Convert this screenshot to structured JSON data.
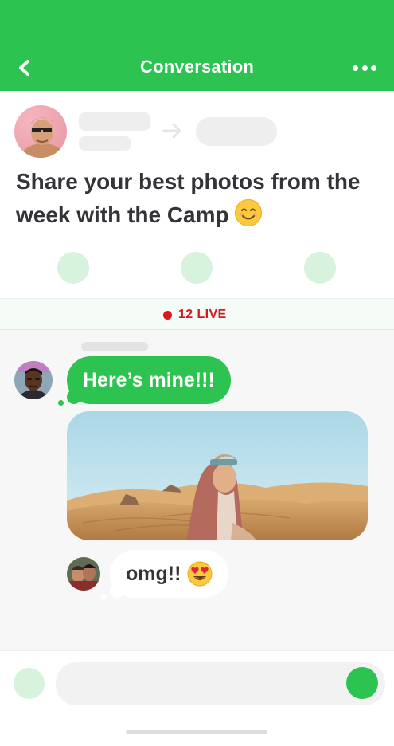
{
  "colors": {
    "accent": "#2cc350",
    "live": "#e0161e",
    "reaction": "#d7f2dd"
  },
  "header": {
    "title": "Conversation",
    "back_icon": "chevron-left-icon",
    "more_icon": "more-horizontal-icon"
  },
  "post": {
    "text": "Share your best photos from the week with the Camp",
    "emoji": "smiling-face-icon",
    "reactions": 3
  },
  "live": {
    "count_label": "12 LIVE"
  },
  "messages": [
    {
      "type": "text",
      "style": "green",
      "text": "Here’s mine!!!"
    },
    {
      "type": "image",
      "description_icon": "photo-desert-woman"
    },
    {
      "type": "text",
      "style": "white",
      "text": "omg!!",
      "emoji": "heart-eyes-icon"
    }
  ],
  "composer": {
    "placeholder": ""
  }
}
